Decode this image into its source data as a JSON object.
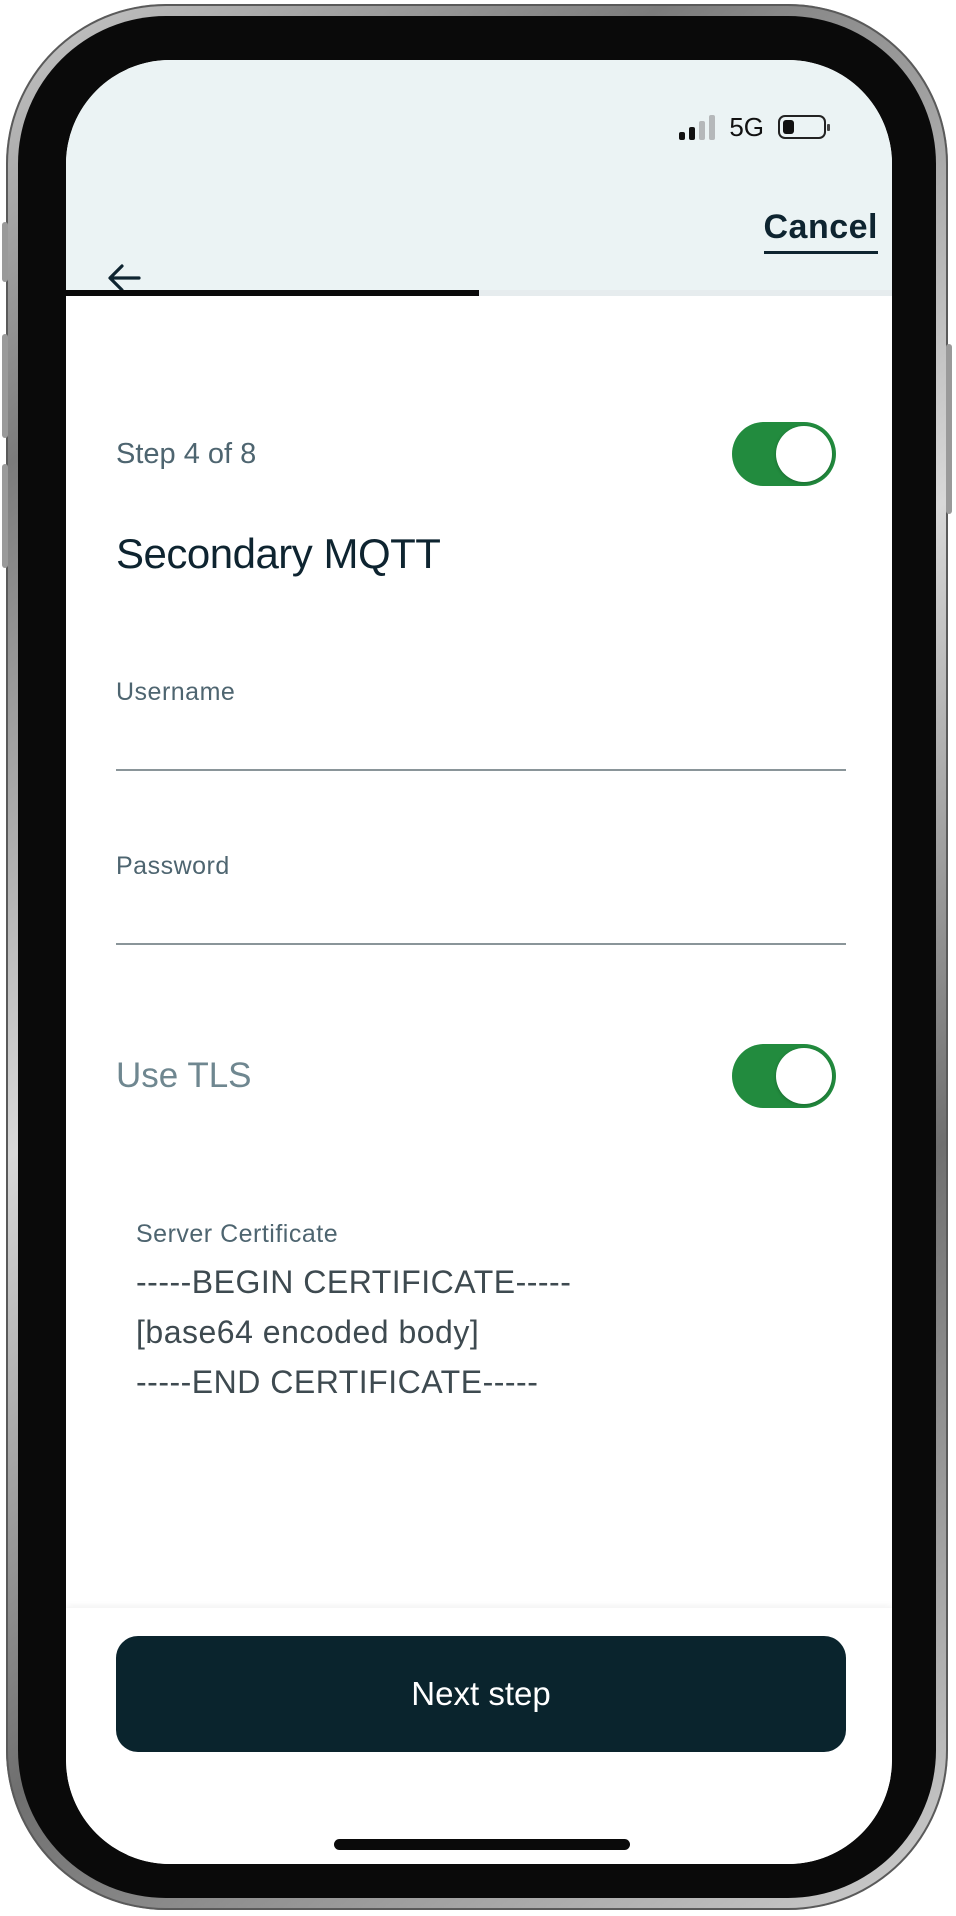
{
  "status_bar": {
    "network": "5G",
    "signal_bars_active": 2,
    "signal_bars_total": 4,
    "battery_level": 0.3
  },
  "header": {
    "back_icon": "arrow-left-icon",
    "cancel_label": "Cancel",
    "progress": 0.5
  },
  "form": {
    "step_label": "Step 4 of 8",
    "enabled": true,
    "title": "Secondary MQTT",
    "username_label": "Username",
    "username_value": "",
    "password_label": "Password",
    "password_value": "",
    "tls_label": "Use TLS",
    "tls_enabled": true,
    "certificate_label": "Server Certificate",
    "certificate_value": "-----BEGIN CERTIFICATE-----\n[base64 encoded body]\n-----END CERTIFICATE-----"
  },
  "footer": {
    "next_label": "Next step"
  },
  "colors": {
    "header_bg": "#ebf3f4",
    "toggle_on": "#228b3e",
    "primary_dark": "#0a242d",
    "text_dark": "#0e2430",
    "text_muted": "#4e6570"
  }
}
